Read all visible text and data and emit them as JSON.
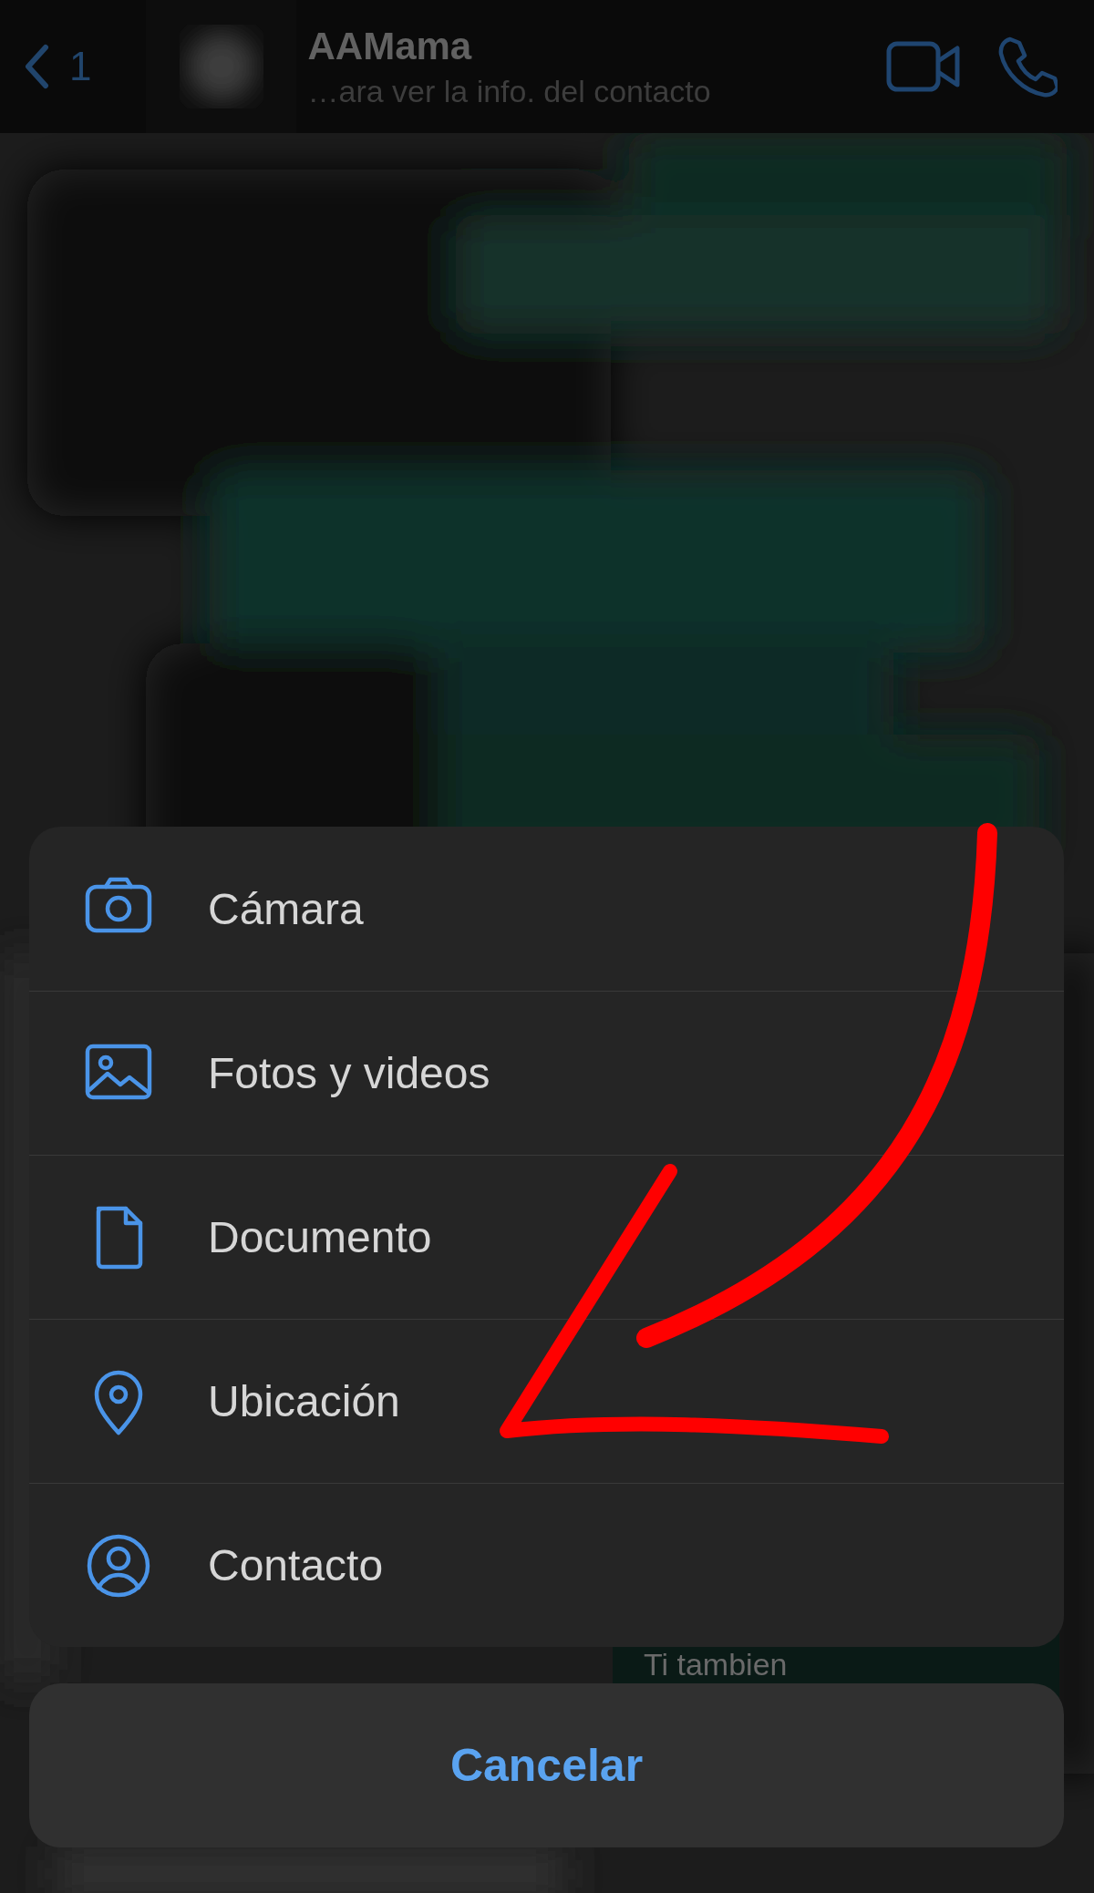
{
  "header": {
    "back_count": "1",
    "name": "AAMama",
    "subtitle": "…ara ver la info. del contacto"
  },
  "chat": {
    "visible_message": "Ti tambien"
  },
  "menu": {
    "items": [
      {
        "kind": "camera",
        "label": "Cámara"
      },
      {
        "kind": "photos",
        "label": "Fotos y videos"
      },
      {
        "kind": "document",
        "label": "Documento"
      },
      {
        "kind": "location",
        "label": "Ubicación"
      },
      {
        "kind": "contact",
        "label": "Contacto"
      }
    ],
    "cancel": "Cancelar"
  }
}
